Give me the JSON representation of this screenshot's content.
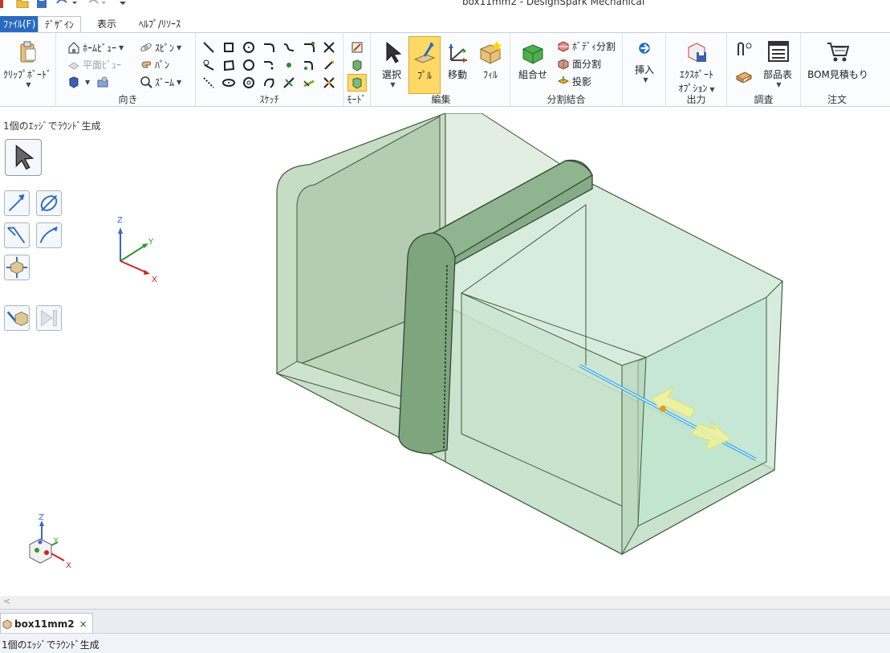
{
  "window": {
    "title": "box11mm2 - DesignSpark Mechanical"
  },
  "menu": {
    "file": "ﾌｧｲﾙ(F)",
    "design": "ﾃﾞｻﾞｲﾝ",
    "view": "表示",
    "help": "ﾍﾙﾌﾟ/ﾘｿｰｽ"
  },
  "ribbon": {
    "clipboard": {
      "label": "ｸﾘｯﾌﾟﾎﾞｰﾄﾞ"
    },
    "orient": {
      "label": "向き",
      "home_view": "ﾎｰﾑﾋﾞｭｰ",
      "plane_view": "平面ﾋﾞｭｰ",
      "spin": "ｽﾋﾟﾝ",
      "pan": "ﾊﾟﾝ",
      "zoom": "ｽﾞｰﾑ"
    },
    "sketch": {
      "label": "ｽｹｯﾁ"
    },
    "mode": {
      "label": "ﾓｰﾄﾞ"
    },
    "edit": {
      "label": "編集",
      "select": "選択",
      "pull": "ﾌﾟﾙ",
      "move": "移動",
      "fill": "ﾌｨﾙ"
    },
    "intersect": {
      "label": "分割結合",
      "combine": "組合せ",
      "split_body": "ﾎﾞﾃﾞｨ分割",
      "split_face": "面分割",
      "project": "投影"
    },
    "insert": {
      "label": "挿入"
    },
    "output": {
      "label": "出力",
      "export": "ｴｸｽﾎﾟｰﾄ",
      "options": "ｵﾌﾟｼｮﾝ"
    },
    "inspect": {
      "label": "調査",
      "bom": "部品表"
    },
    "order": {
      "label": "注文",
      "bom_quote": "BOM見積もり"
    }
  },
  "viewport": {
    "hint": "1個のｴｯｼﾞでﾗｳﾝﾄﾞ生成",
    "axis": {
      "x": "X",
      "y": "Y",
      "z": "Z"
    }
  },
  "document": {
    "tab": "box11mm2",
    "close": "×"
  },
  "status": {
    "text": "1個のｴｯｼﾞでﾗｳﾝﾄﾞ生成"
  },
  "colors": {
    "accent": "#2a6bbf",
    "pull_highlight": "#ffd966",
    "solid_green": "#7fb77f"
  }
}
